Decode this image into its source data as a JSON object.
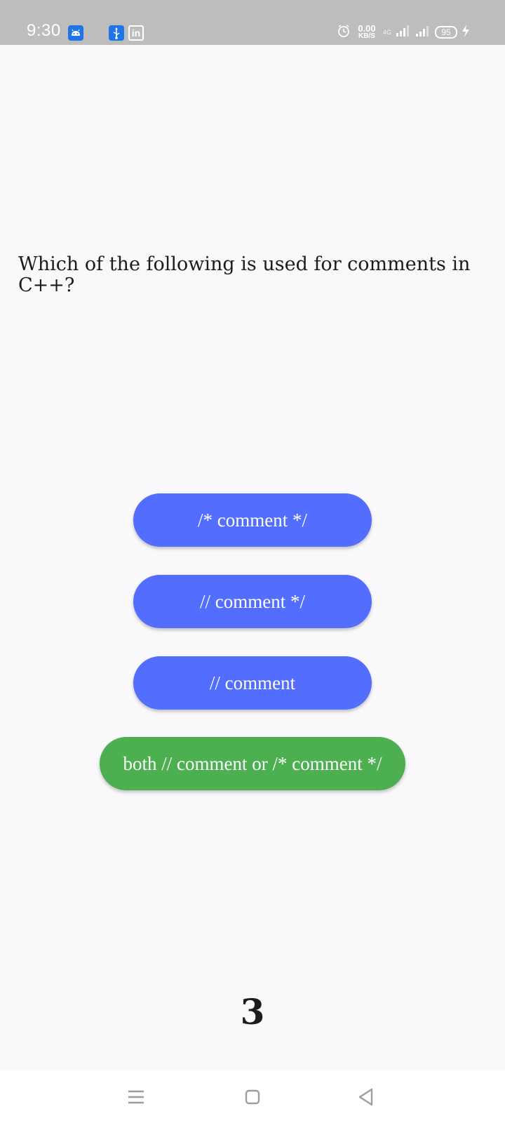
{
  "status_bar": {
    "time": "9:30",
    "net_speed_value": "0.00",
    "net_speed_unit": "KB/S",
    "network_type": "4G",
    "battery_level": "95",
    "icons": [
      "android-notification-icon",
      "usb-icon",
      "linkedin-icon",
      "alarm-icon",
      "signal-icon",
      "signal-icon",
      "battery-icon",
      "charging-icon"
    ]
  },
  "quiz": {
    "question": "Which of the following is used for comments in C++?",
    "answers": [
      {
        "label": "/* comment */",
        "state": "default"
      },
      {
        "label": "// comment */",
        "state": "default"
      },
      {
        "label": "// comment",
        "state": "default"
      },
      {
        "label": "both // comment or /* comment */",
        "state": "correct"
      }
    ],
    "score": "3"
  },
  "colors": {
    "status_bar_bg": "#bdbdbd",
    "page_bg": "#f9f9fb",
    "answer_default": "#536dfe",
    "answer_correct": "#4caf50",
    "text": "#1c1c1c"
  },
  "nav_bar": {
    "icons": [
      "menu-icon",
      "home-icon",
      "back-icon"
    ]
  }
}
